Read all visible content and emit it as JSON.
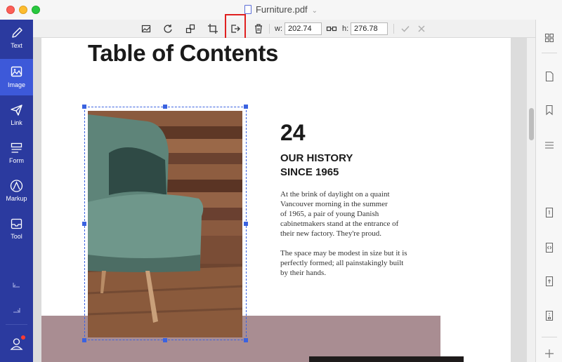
{
  "window": {
    "title": "Furniture.pdf"
  },
  "sidebar": {
    "items": [
      {
        "label": "Text",
        "icon": "pen-icon"
      },
      {
        "label": "Image",
        "icon": "image-icon",
        "active": true
      },
      {
        "label": "Link",
        "icon": "link-send-icon"
      },
      {
        "label": "Form",
        "icon": "form-icon"
      },
      {
        "label": "Markup",
        "icon": "markup-icon"
      },
      {
        "label": "Tool",
        "icon": "toolbox-icon"
      }
    ],
    "accent": "#2b3a9f",
    "active_color": "#3d59d9"
  },
  "toolbar": {
    "buttons": [
      "add-image-icon",
      "rotate-icon",
      "replace-image-icon",
      "crop-icon",
      "extract-image-icon",
      "delete-icon"
    ],
    "highlighted_button": "extract-image-icon",
    "width_label": "w:",
    "width_value": "202.74",
    "height_label": "h:",
    "height_value": "276.78"
  },
  "page": {
    "title": "Table of Contents",
    "page_number": "24",
    "heading_line1": "OUR HISTORY",
    "heading_line2": "SINCE 1965",
    "para1": [
      "At the brink of daylight on a quaint",
      "Vancouver morning in the summer",
      "of 1965, a pair of young Danish",
      "cabinetmakers stand at the entrance of",
      "their new factory. They're proud."
    ],
    "para2": [
      "The space may be modest in size but it is",
      "perfectly formed; all painstakingly built",
      "by their hands."
    ]
  },
  "right_panel": {
    "icons": [
      "thumbnails-icon",
      "page-icon",
      "bookmark-icon",
      "outline-icon",
      "page-number-icon",
      "embed-icon",
      "attachment-icon",
      "compress-icon",
      "add-icon"
    ]
  },
  "colors": {
    "mauve": "#a98d92",
    "selection": "#3a62e0",
    "highlight": "#e02020"
  }
}
